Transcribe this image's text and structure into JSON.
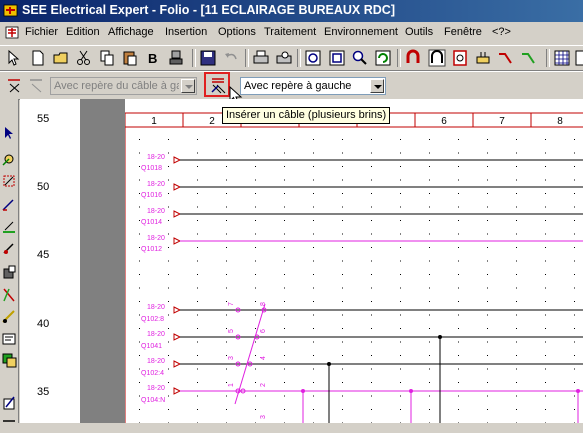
{
  "window": {
    "title": "SEE Electrical Expert - Folio - [11 ECLAIRAGE BUREAUX RDC]"
  },
  "menu": [
    "Fichier",
    "Edition",
    "Affichage",
    "Insertion",
    "Options",
    "Traitement",
    "Environnement",
    "Outils",
    "Fenêtre",
    "<?>"
  ],
  "toolbar2": {
    "combo1_value": "Avec repère du câble à ga",
    "combo2_value": "Avec repère à gauche",
    "tooltip": "Insérer un câble (plusieurs brins)"
  },
  "ruler": {
    "numbers": [
      "55",
      "50",
      "45",
      "40",
      "35"
    ]
  },
  "columns": [
    "1",
    "2",
    "3",
    "4",
    "5",
    "6",
    "7",
    "8"
  ],
  "wires": [
    {
      "top": "18-20",
      "bottom": "Q1018",
      "color": "#000000"
    },
    {
      "top": "18-20",
      "bottom": "Q1016",
      "color": "#000000"
    },
    {
      "top": "18-20",
      "bottom": "Q1014",
      "color": "#000000"
    },
    {
      "top": "18-20",
      "bottom": "Q1012",
      "color": "#e020e0"
    },
    {
      "top": "18-20",
      "bottom": "Q102:8",
      "color": "#000000"
    },
    {
      "top": "18-20",
      "bottom": "Q1041",
      "color": "#000000"
    },
    {
      "top": "18-20",
      "bottom": "Q102:4",
      "color": "#000000"
    },
    {
      "top": "18-20",
      "bottom": "Q104:N",
      "color": "#e020e0"
    }
  ],
  "cable_marks": [
    "7",
    "8",
    "5",
    "6",
    "3",
    "4",
    "1",
    "2",
    "3"
  ],
  "colors": {
    "title_start": "#0a246a",
    "title_end": "#3a6ea5",
    "magenta": "#e020e0",
    "highlight": "#e02020",
    "tooltip_bg": "#ffffe1"
  }
}
